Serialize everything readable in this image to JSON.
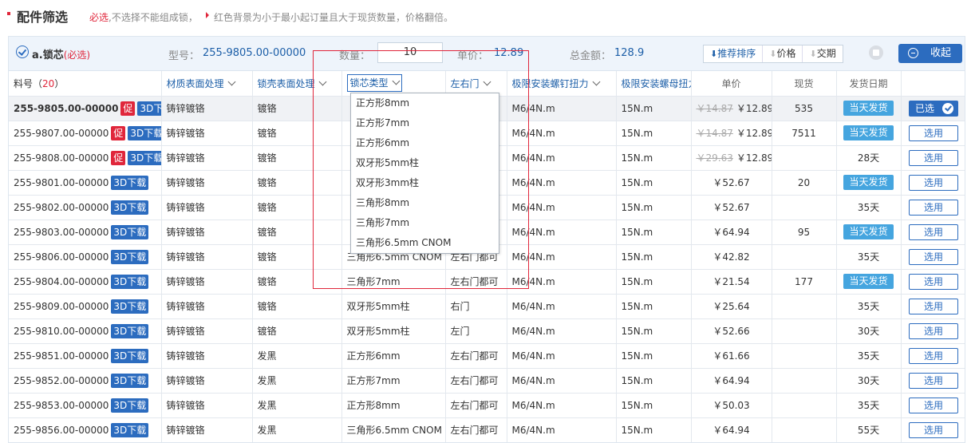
{
  "top": {
    "title": "配件筛选",
    "required_word": "必选",
    "note1": ",不选择不能组成锁，",
    "note2": "红色背景为小于最小起订量且大于现货数量，价格翻倍。"
  },
  "header": {
    "part_name": "a.锁芯",
    "part_required": "(必选)",
    "model_label": "型号：",
    "model_value": "255-9805.00-00000",
    "qty_label": "数量：",
    "qty_value": "10",
    "unit_price_label": "单价：",
    "unit_price_value": "12.89",
    "total_label": "总金额：",
    "total_value": "128.9",
    "sort_recommend": "推荐排序",
    "sort_price": "价格",
    "sort_delivery": "交期",
    "collapse_label": "收起"
  },
  "columns": {
    "part_no": "料号（",
    "count": "20",
    "part_no_end": "）",
    "material": "材质表面处理",
    "shell": "锁壳表面处理",
    "lock_type": "锁芯类型",
    "door": "左右门",
    "torque": "极限安装螺钉扭力",
    "nut_torque": "极限安装螺母扭力",
    "price": "单价",
    "stock": "现货",
    "ship_date": "发货日期"
  },
  "labels": {
    "promo": "促",
    "download_3d": "3D下载",
    "picked": "已选",
    "pick": "选用"
  },
  "rows": [
    {
      "pno": "255-9805.00-00000",
      "promo": true,
      "mat": "铸锌镀铬",
      "shell": "镀铬",
      "type": "",
      "door": "",
      "torque": "M6/4N.m",
      "nut": "15N.m",
      "old": "￥14.87",
      "price": "￥12.89",
      "stock": "535",
      "ship": "当天发货",
      "ship_badge": true,
      "selected": true
    },
    {
      "pno": "255-9807.00-00000",
      "promo": true,
      "mat": "铸锌镀铬",
      "shell": "镀铬",
      "type": "",
      "door": "",
      "torque": "M6/4N.m",
      "nut": "15N.m",
      "old": "￥14.87",
      "price": "￥12.89",
      "stock": "7511",
      "ship": "当天发货",
      "ship_badge": true
    },
    {
      "pno": "255-9808.00-00000",
      "promo": true,
      "mat": "铸锌镀铬",
      "shell": "镀铬",
      "type": "",
      "door": "",
      "torque": "M6/4N.m",
      "nut": "15N.m",
      "old": "￥29.63",
      "price": "￥12.89",
      "stock": "",
      "ship": "28天",
      "ship_badge": false
    },
    {
      "pno": "255-9801.00-00000",
      "promo": false,
      "mat": "铸锌镀铬",
      "shell": "镀铬",
      "type": "",
      "door": "",
      "torque": "M6/4N.m",
      "nut": "15N.m",
      "old": "",
      "price": "￥52.67",
      "stock": "20",
      "ship": "当天发货",
      "ship_badge": true
    },
    {
      "pno": "255-9802.00-00000",
      "promo": false,
      "mat": "铸锌镀铬",
      "shell": "镀铬",
      "type": "",
      "door": "",
      "torque": "M6/4N.m",
      "nut": "15N.m",
      "old": "",
      "price": "￥52.67",
      "stock": "",
      "ship": "35天",
      "ship_badge": false
    },
    {
      "pno": "255-9803.00-00000",
      "promo": false,
      "mat": "铸锌镀铬",
      "shell": "镀铬",
      "type": "",
      "door": "",
      "torque": "M6/4N.m",
      "nut": "15N.m",
      "old": "",
      "price": "￥64.94",
      "stock": "95",
      "ship": "当天发货",
      "ship_badge": true
    },
    {
      "pno": "255-9806.00-00000",
      "promo": false,
      "mat": "铸锌镀铬",
      "shell": "镀铬",
      "type": "三角形6.5mm CNOM",
      "door": "左右门都可",
      "torque": "M6/4N.m",
      "nut": "15N.m",
      "old": "",
      "price": "￥42.82",
      "stock": "",
      "ship": "35天",
      "ship_badge": false
    },
    {
      "pno": "255-9804.00-00000",
      "promo": false,
      "mat": "铸锌镀铬",
      "shell": "镀铬",
      "type": "三角形7mm",
      "door": "左右门都可",
      "torque": "M6/4N.m",
      "nut": "15N.m",
      "old": "",
      "price": "￥21.54",
      "stock": "177",
      "ship": "当天发货",
      "ship_badge": true
    },
    {
      "pno": "255-9809.00-00000",
      "promo": false,
      "mat": "铸锌镀铬",
      "shell": "镀铬",
      "type": "双牙形5mm柱",
      "door": "右门",
      "torque": "M6/4N.m",
      "nut": "15N.m",
      "old": "",
      "price": "￥25.64",
      "stock": "",
      "ship": "35天",
      "ship_badge": false
    },
    {
      "pno": "255-9810.00-00000",
      "promo": false,
      "mat": "铸锌镀铬",
      "shell": "镀铬",
      "type": "双牙形5mm柱",
      "door": "左门",
      "torque": "M6/4N.m",
      "nut": "15N.m",
      "old": "",
      "price": "￥52.66",
      "stock": "",
      "ship": "30天",
      "ship_badge": false
    },
    {
      "pno": "255-9851.00-00000",
      "promo": false,
      "mat": "铸锌镀铬",
      "shell": "发黑",
      "type": "正方形6mm",
      "door": "左右门都可",
      "torque": "M6/4N.m",
      "nut": "15N.m",
      "old": "",
      "price": "￥61.66",
      "stock": "",
      "ship": "35天",
      "ship_badge": false
    },
    {
      "pno": "255-9852.00-00000",
      "promo": false,
      "mat": "铸锌镀铬",
      "shell": "发黑",
      "type": "正方形7mm",
      "door": "左右门都可",
      "torque": "M6/4N.m",
      "nut": "15N.m",
      "old": "",
      "price": "￥64.94",
      "stock": "",
      "ship": "30天",
      "ship_badge": false
    },
    {
      "pno": "255-9853.00-00000",
      "promo": false,
      "mat": "铸锌镀铬",
      "shell": "发黑",
      "type": "正方形8mm",
      "door": "左右门都可",
      "torque": "M6/4N.m",
      "nut": "15N.m",
      "old": "",
      "price": "￥50.03",
      "stock": "",
      "ship": "35天",
      "ship_badge": false
    },
    {
      "pno": "255-9856.00-00000",
      "promo": false,
      "mat": "铸锌镀铬",
      "shell": "发黑",
      "type": "三角形6.5mm CNOM",
      "door": "左右门都可",
      "torque": "M6/4N.m",
      "nut": "15N.m",
      "old": "",
      "price": "￥64.94",
      "stock": "",
      "ship": "55天",
      "ship_badge": false
    }
  ],
  "dropdown_options": [
    "正方形8mm",
    "正方形7mm",
    "正方形6mm",
    "双牙形5mm柱",
    "双牙形3mm柱",
    "三角形8mm",
    "三角形7mm",
    "三角形6.5mm CNOM"
  ],
  "colors": {
    "accent": "#2c6cbf",
    "required": "#e0263b",
    "ship_badge": "#45a5df"
  }
}
